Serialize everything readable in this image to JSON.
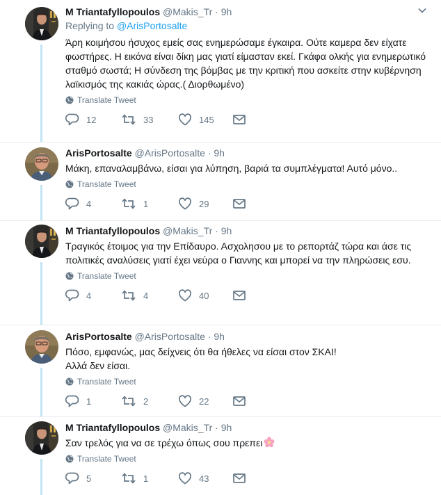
{
  "icons": {
    "reply": "reply-icon",
    "retweet": "retweet-icon",
    "like": "heart-icon",
    "dm": "envelope-icon",
    "translate": "globe-icon",
    "caret": "chevron-down-icon"
  },
  "colors": {
    "link": "#1da1f2",
    "meta": "#657786",
    "thread_line": "#c4e4f6"
  },
  "tweets": [
    {
      "name": "M Triantafyllopoulos",
      "handle": "@Makis_Tr",
      "time": "· 9h",
      "replying_prefix": "Replying to ",
      "replying_to": "@ArisPortosalte",
      "lines": [
        "Άρη κοιμήσου ήσυχος εμείς σας ενημερώσαμε έγκαιρα. Ούτε καμερα δεν είχατε φωστήρες. Η εικόνα είναι δίκη μας γιατί είμασταν εκεί. Γκάφα ολκής για ενημερωτικό σταθμό σωστά; Η σύνδεση της βόμβας με την κριτική που ασκείτε στην κυβέρνηση λαϊκισμός της κακιάς ώρας.( Διορθωμένο)"
      ],
      "translate": "Translate Tweet",
      "replies": "12",
      "retweets": "33",
      "likes": "145"
    },
    {
      "name": "ArisPortosalte",
      "handle": "@ArisPortosalte",
      "time": "· 9h",
      "lines": [
        "Μάκη, επαναλαμβάνω, είσαι για λύπηση, βαριά τα συμπλέγματα! Αυτό μόνο.."
      ],
      "translate": "Translate Tweet",
      "replies": "4",
      "retweets": "1",
      "likes": "29"
    },
    {
      "name": "M Triantafyllopoulos",
      "handle": "@Makis_Tr",
      "time": "· 9h",
      "lines": [
        "Τραγικός έτοιμος για την Επίδαυρο. Ασχολησου με το ρεπορτάζ τώρα και άσε τις πολιτικές αναλύσεις γιατί έχει νεύρα ο Γιαννης και μπορεί να την πληρώσεις εσυ."
      ],
      "translate": "Translate Tweet",
      "replies": "4",
      "retweets": "4",
      "likes": "40"
    },
    {
      "name": "ArisPortosalte",
      "handle": "@ArisPortosalte",
      "time": "· 9h",
      "lines": [
        "Πόσο, εμφανώς, μας δείχνεις ότι θα ήθελες να είσαι στον ΣΚΑΙ!",
        "Αλλά δεν είσαι."
      ],
      "translate": "Translate Tweet",
      "replies": "1",
      "retweets": "2",
      "likes": "22"
    },
    {
      "name": "M Triantafyllopoulos",
      "handle": "@Makis_Tr",
      "time": "· 9h",
      "lines": [
        "Σαν τρελός για να σε τρέχω όπως σου πρεπει"
      ],
      "emoji": "cherry-blossom-emoji",
      "translate": "Translate Tweet",
      "replies": "5",
      "retweets": "1",
      "likes": "43"
    }
  ]
}
